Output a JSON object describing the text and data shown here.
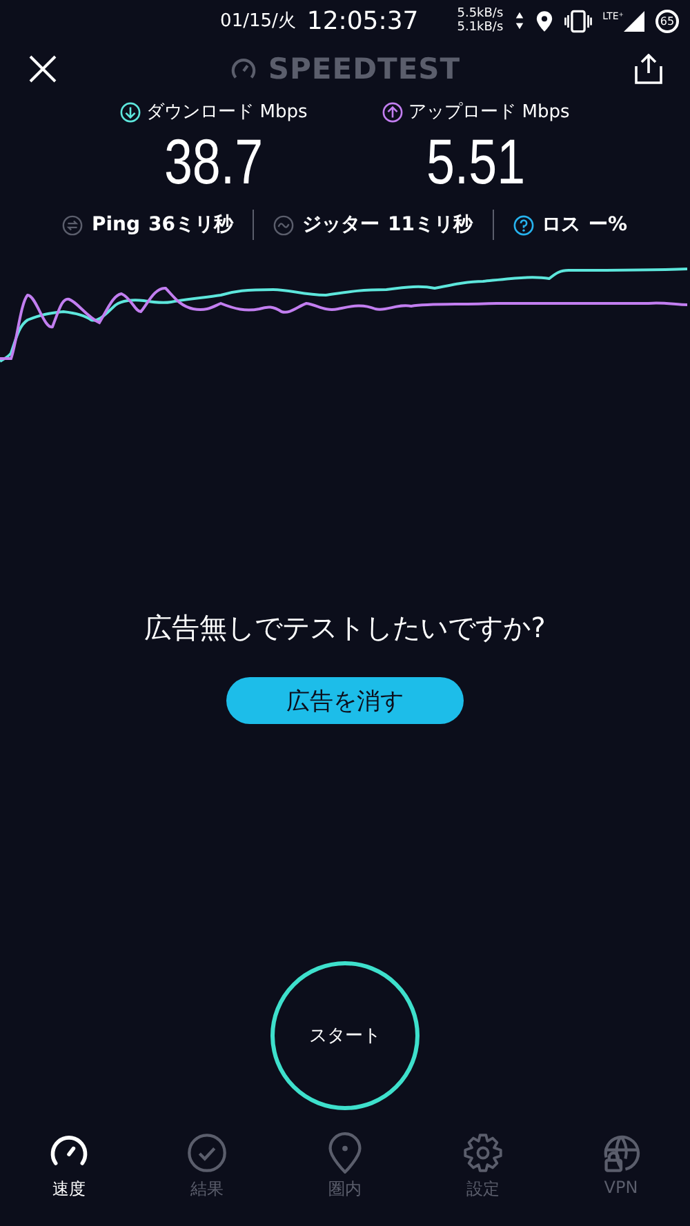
{
  "status_bar": {
    "date": "01/15/火",
    "time": "12:05:37",
    "rate_up": "5.5kB/s",
    "rate_down": "5.1kB/s",
    "network": "LTE⁺",
    "battery": "65"
  },
  "header": {
    "title": "SPEEDTEST"
  },
  "results": [
    {
      "kind": "download",
      "label": "ダウンロード Mbps",
      "value": "38.7"
    },
    {
      "kind": "upload",
      "label": "アップロード Mbps",
      "value": "5.51"
    }
  ],
  "stats": [
    {
      "kind": "ping",
      "label": "Ping",
      "value": "36ミリ秒"
    },
    {
      "kind": "jitter",
      "label": "ジッター",
      "value": "11ミリ秒"
    },
    {
      "kind": "loss",
      "label": "ロス",
      "value": "ー%"
    }
  ],
  "ad_prompt": {
    "text": "広告無しでテストしたいですか?",
    "button": "広告を消す"
  },
  "start_button": "スタート",
  "nav": [
    {
      "kind": "speed",
      "label": "速度",
      "selected": true
    },
    {
      "kind": "results",
      "label": "結果",
      "selected": false
    },
    {
      "kind": "coverage",
      "label": "圏内",
      "selected": false
    },
    {
      "kind": "settings",
      "label": "設定",
      "selected": false
    },
    {
      "kind": "vpn",
      "label": "VPN",
      "selected": false
    }
  ]
}
